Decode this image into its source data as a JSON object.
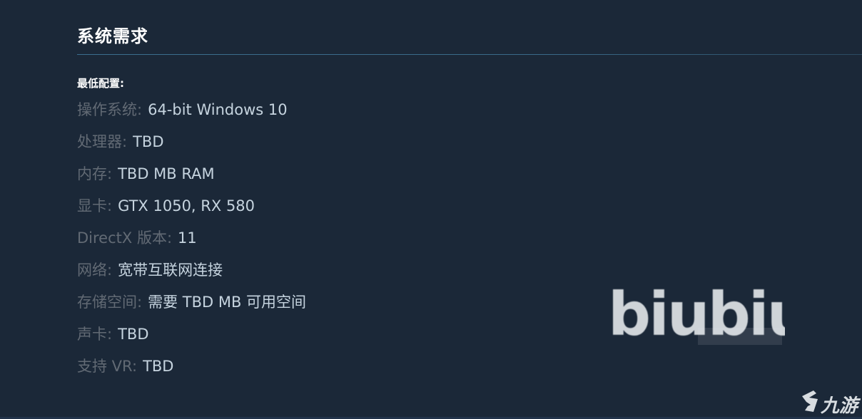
{
  "section": {
    "title": "系统需求",
    "min_label": "最低配置:"
  },
  "requirements": [
    {
      "key": "操作系统:",
      "value": "64-bit Windows 10"
    },
    {
      "key": "处理器:",
      "value": "TBD"
    },
    {
      "key": "内存:",
      "value": "TBD MB RAM"
    },
    {
      "key": "显卡:",
      "value": "GTX 1050, RX 580"
    },
    {
      "key": "DirectX 版本:",
      "value": "11"
    },
    {
      "key": "网络:",
      "value": "宽带互联网连接"
    },
    {
      "key": "存储空间:",
      "value": "需要 TBD MB 可用空间"
    },
    {
      "key": "声卡:",
      "value": "TBD"
    },
    {
      "key": "支持 VR:",
      "value": "TBD"
    }
  ],
  "watermarks": {
    "biubiu": "biubiu",
    "site": "九游"
  },
  "colors": {
    "background": "#1b2838",
    "title": "#ffffff",
    "key_text": "#626a74",
    "value_text": "#c6d4df",
    "rule": "#3c6f8f"
  }
}
